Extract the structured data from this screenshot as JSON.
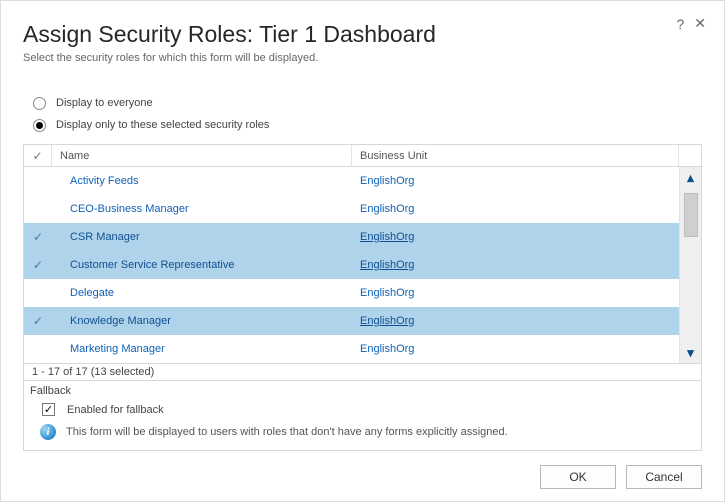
{
  "header": {
    "title": "Assign Security Roles: Tier 1 Dashboard",
    "subtitle": "Select the security roles for which this form will be displayed."
  },
  "radios": {
    "everyone": "Display to everyone",
    "selected": "Display only to these selected security roles"
  },
  "columns": {
    "name": "Name",
    "bu": "Business Unit"
  },
  "rows": [
    {
      "name": "Activity Feeds",
      "bu": "EnglishOrg",
      "selected": false
    },
    {
      "name": "CEO-Business Manager",
      "bu": "EnglishOrg",
      "selected": false
    },
    {
      "name": "CSR Manager",
      "bu": "EnglishOrg",
      "selected": true
    },
    {
      "name": "Customer Service Representative",
      "bu": "EnglishOrg",
      "selected": true
    },
    {
      "name": "Delegate",
      "bu": "EnglishOrg",
      "selected": false
    },
    {
      "name": "Knowledge Manager",
      "bu": "EnglishOrg",
      "selected": true
    },
    {
      "name": "Marketing Manager",
      "bu": "EnglishOrg",
      "selected": false
    }
  ],
  "status": "1 - 17 of 17 (13 selected)",
  "fallback": {
    "heading": "Fallback",
    "checkbox_label": "Enabled for fallback",
    "info": "This form will be displayed to users with roles that don't have any forms explicitly assigned."
  },
  "buttons": {
    "ok": "OK",
    "cancel": "Cancel"
  },
  "icons": {
    "help": "?",
    "close": "✕"
  }
}
